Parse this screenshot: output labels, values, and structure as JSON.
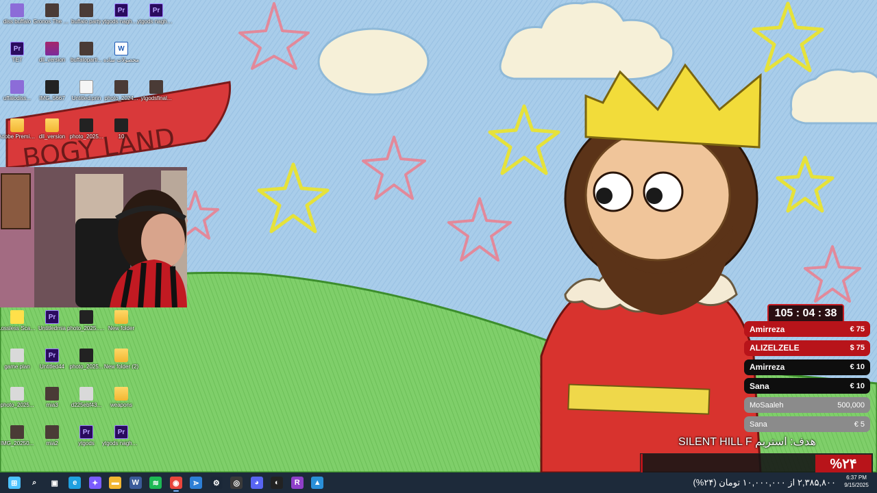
{
  "wallpaper": {
    "banner_text": "BOGY LAND"
  },
  "desktop_icons": [
    {
      "label": "diss buffalo",
      "kind": "purple"
    },
    {
      "label": "Gronos The New Dawn",
      "kind": "photo"
    },
    {
      "label": "buffalo party",
      "kind": "photo"
    },
    {
      "label": "ytgods naghes cut",
      "kind": "pr"
    },
    {
      "label": "ytgods naghes cut 3",
      "kind": "pr"
    },
    {
      "label": "TET",
      "kind": "pr"
    },
    {
      "label": "dll_version",
      "kind": "winrar"
    },
    {
      "label": "buffaloparti...",
      "kind": "photo"
    },
    {
      "label": "محصولات ساده",
      "kind": "word"
    },
    {
      "label": "uffalodiss...",
      "kind": "purple"
    },
    {
      "label": "IMG_5667",
      "kind": "dark"
    },
    {
      "label": "Untitled.prin",
      "kind": "txt"
    },
    {
      "label": "photo_2024...",
      "kind": "photo"
    },
    {
      "label": "ytgodsfinal...",
      "kind": "photo"
    },
    {
      "label": "Adobe Premiere Pr...",
      "kind": "folder"
    },
    {
      "label": "dll_version",
      "kind": "folder"
    },
    {
      "label": "photo_2025...",
      "kind": "dark"
    },
    {
      "label": "10",
      "kind": "dark"
    },
    {
      "label": "Lossless Scaling",
      "kind": "lossless"
    },
    {
      "label": "Untitledmia",
      "kind": "pr"
    },
    {
      "label": "photo_2025... (3)",
      "kind": "dark"
    },
    {
      "label": "New folder",
      "kind": "folder"
    },
    {
      "label": "game plan",
      "kind": "game"
    },
    {
      "label": "Untitled44",
      "kind": "pr"
    },
    {
      "label": "photo_2025...",
      "kind": "dark"
    },
    {
      "label": "New folder (2)",
      "kind": "folder"
    },
    {
      "label": "photo_2025...",
      "kind": "game"
    },
    {
      "label": "mia3",
      "kind": "photo"
    },
    {
      "label": "d225ebf43...",
      "kind": "game"
    },
    {
      "label": "weapons",
      "kind": "folder"
    },
    {
      "label": "IMG_20250...",
      "kind": "photo"
    },
    {
      "label": "mia2",
      "kind": "photo"
    },
    {
      "label": "ytgods",
      "kind": "pr"
    },
    {
      "label": "ytgods naghes cut 2",
      "kind": "pr"
    }
  ],
  "overlay": {
    "timer": "105 : 04 : 38",
    "donations": [
      {
        "name": "Amirreza",
        "amount": "€ 75",
        "style": "red"
      },
      {
        "name": "ALIZELZELE",
        "amount": "$ 75",
        "style": "red"
      },
      {
        "name": "Amirreza",
        "amount": "€ 10",
        "style": "black"
      },
      {
        "name": "Sana",
        "amount": "€ 10",
        "style": "black"
      },
      {
        "name": "MoSaaleh",
        "amount": "500,000",
        "style": "gray"
      },
      {
        "name": "Sana",
        "amount": "€ 5",
        "style": "gray"
      }
    ],
    "goal_label": "هدف: استریم SILENT HILL F",
    "goal_percent_label": "%۲۴",
    "goal_progress": 0.01,
    "goal_footer": "۲,۳۸۵,۸۰۰ از ۱۰,۰۰۰,۰۰۰ تومان (۲۴%)"
  },
  "taskbar": {
    "apps": [
      {
        "name": "start",
        "glyph": "⊞",
        "color": "#4cc2ff"
      },
      {
        "name": "search",
        "glyph": "⌕",
        "color": "#1d2a3a"
      },
      {
        "name": "task-view",
        "glyph": "▣",
        "color": "#1d2a3a"
      },
      {
        "name": "edge",
        "glyph": "e",
        "color": "#1fa0e0"
      },
      {
        "name": "copilot",
        "glyph": "✦",
        "color": "#7a5cff"
      },
      {
        "name": "file-explorer",
        "glyph": "▬",
        "color": "#f2b632"
      },
      {
        "name": "wordpad",
        "glyph": "W",
        "color": "#3b5b9a"
      },
      {
        "name": "spotify",
        "glyph": "≋",
        "color": "#1db954"
      },
      {
        "name": "chrome",
        "glyph": "◉",
        "color": "#e8453c"
      },
      {
        "name": "premiere-vs",
        "glyph": "⋗",
        "color": "#2d7fd6"
      },
      {
        "name": "steam",
        "glyph": "⚙",
        "color": "#1b2838"
      },
      {
        "name": "obs",
        "glyph": "◎",
        "color": "#3a3a3a"
      },
      {
        "name": "discord",
        "glyph": "◕",
        "color": "#5865f2"
      },
      {
        "name": "github",
        "glyph": "◐",
        "color": "#222"
      },
      {
        "name": "rider",
        "glyph": "R",
        "color": "#8f3fc9"
      },
      {
        "name": "photos",
        "glyph": "▲",
        "color": "#2a8fd8"
      }
    ],
    "time": "6:37 PM",
    "date": "9/15/2025"
  }
}
